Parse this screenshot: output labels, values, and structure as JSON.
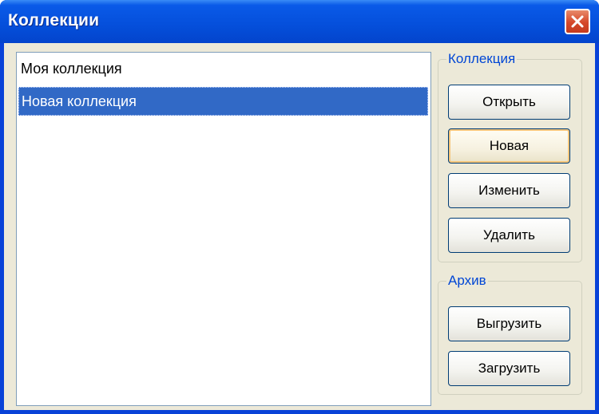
{
  "window": {
    "title": "Коллекции"
  },
  "collections_list": {
    "items": [
      {
        "label": "Моя коллекция",
        "selected": false
      },
      {
        "label": "Новая коллекция",
        "selected": true
      }
    ]
  },
  "collection_group": {
    "legend": "Коллекция",
    "buttons": {
      "open": "Открыть",
      "new": "Новая",
      "edit": "Изменить",
      "delete": "Удалить"
    }
  },
  "archive_group": {
    "legend": "Архив",
    "buttons": {
      "export": "Выгрузить",
      "import": "Загрузить"
    }
  },
  "colors": {
    "titlebar": "#0550dc",
    "selection": "#3169c6",
    "legend_text": "#0046d5",
    "close_button": "#d5482a"
  }
}
